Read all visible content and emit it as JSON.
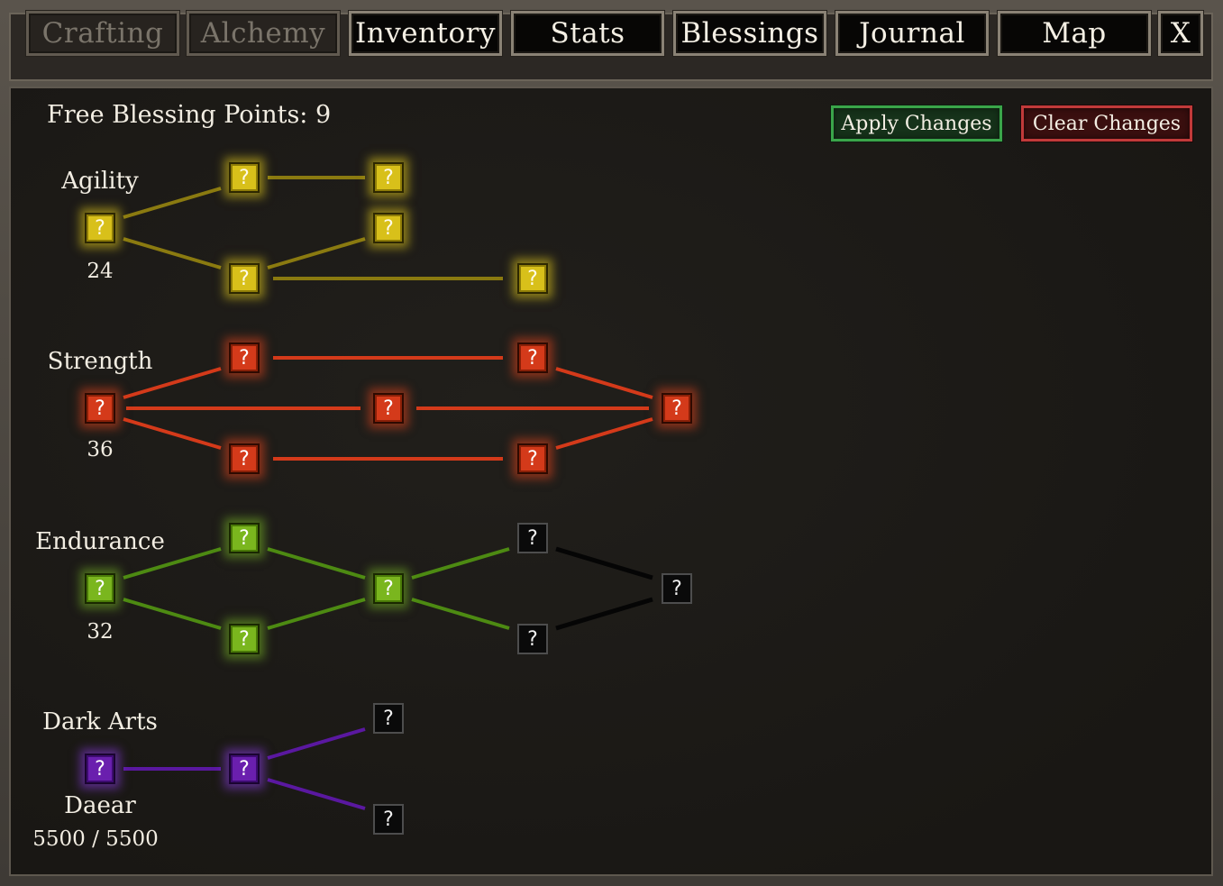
{
  "tabs": [
    {
      "label": "Crafting",
      "enabled": false
    },
    {
      "label": "Alchemy",
      "enabled": false
    },
    {
      "label": "Inventory",
      "enabled": true
    },
    {
      "label": "Stats",
      "enabled": true
    },
    {
      "label": "Blessings",
      "enabled": true
    },
    {
      "label": "Journal",
      "enabled": true
    },
    {
      "label": "Map",
      "enabled": true
    }
  ],
  "close_label": "X",
  "free_points_label": "Free Blessing Points: 9",
  "apply_label": "Apply Changes",
  "clear_label": "Clear Changes",
  "node_glyph": "?",
  "trees": {
    "agility": {
      "label": "Agility",
      "value": "24",
      "color": "#d8c01a"
    },
    "strength": {
      "label": "Strength",
      "value": "36",
      "color": "#d43a1a"
    },
    "endurance": {
      "label": "Endurance",
      "value": "32",
      "color": "#7ab61e"
    },
    "dark_arts": {
      "label": "Dark Arts",
      "deity": "Daear",
      "value": "5500 / 5500",
      "color": "#6a1fae"
    }
  },
  "colors": {
    "apply_border": "#3aa54a",
    "clear_border": "#c13a3a",
    "locked": "#0a0a0a"
  }
}
